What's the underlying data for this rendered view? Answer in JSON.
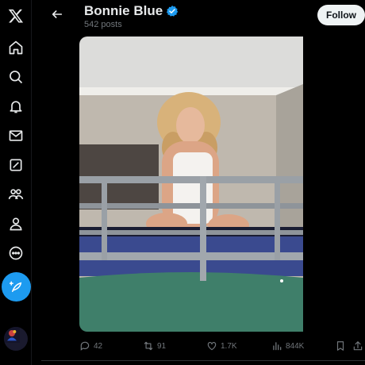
{
  "profile": {
    "name": "Bonnie Blue",
    "post_count": "542 posts",
    "follow_label": "Follow"
  },
  "nav": {
    "items": [
      "x-logo-icon",
      "home-icon",
      "explore-icon",
      "notifications-icon",
      "messages-icon",
      "grok-icon",
      "communities-icon",
      "profile-icon",
      "more-icon"
    ]
  },
  "stats": {
    "replies": "42",
    "reposts": "91",
    "likes": "1.7K",
    "views": "844K"
  },
  "colors": {
    "accent": "#1d9bf0",
    "background": "#000000",
    "muted": "#71767b"
  }
}
